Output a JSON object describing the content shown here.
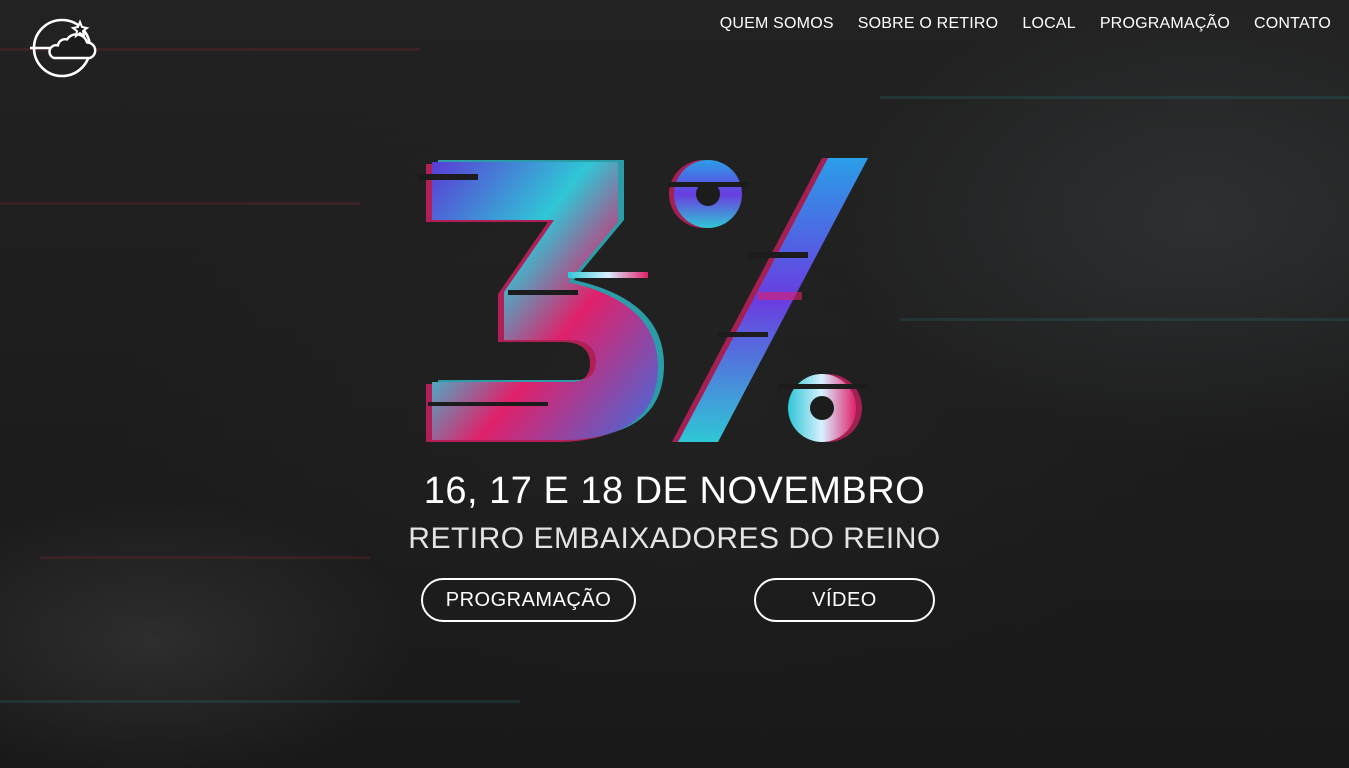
{
  "header": {
    "logo_icon": "cloud-star-circle-icon",
    "nav": [
      {
        "label": "QUEM SOMOS"
      },
      {
        "label": "SOBRE O RETIRO"
      },
      {
        "label": "LOCAL"
      },
      {
        "label": "PROGRAMAÇÃO"
      },
      {
        "label": "CONTATO"
      }
    ]
  },
  "hero": {
    "graphic_text": "3°/°",
    "date": "16, 17 E 18 DE NOVEMBRO",
    "subtitle": "RETIRO EMBAIXADORES DO REINO",
    "buttons": {
      "programacao": "PROGRAMAÇÃO",
      "video": "VÍDEO"
    }
  },
  "colors": {
    "background": "#1c1c1c",
    "text": "#ffffff",
    "glitch_cyan": "#2fc7d6",
    "glitch_magenta": "#e0206a",
    "glitch_purple": "#5a3bd6"
  }
}
